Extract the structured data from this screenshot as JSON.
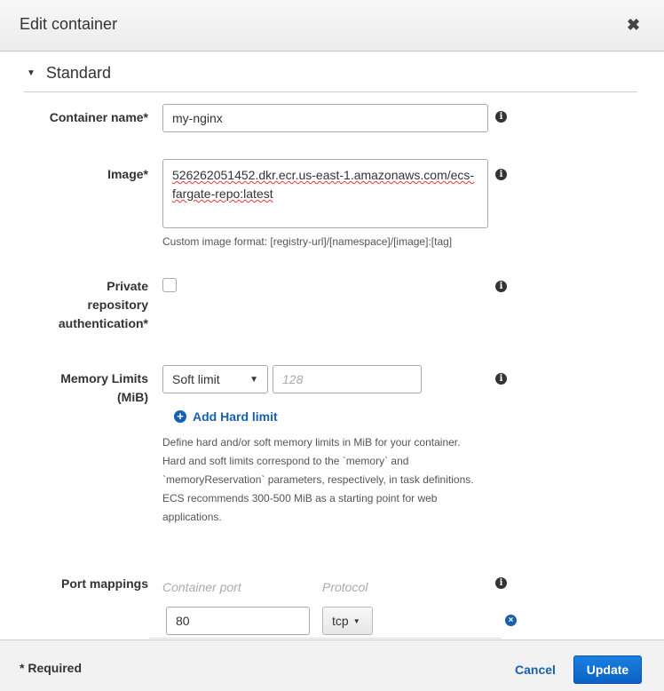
{
  "dialog": {
    "title": "Edit container",
    "close_icon": "close-icon"
  },
  "section": {
    "title": "Standard"
  },
  "container_name": {
    "label": "Container name*",
    "value": "my-nginx"
  },
  "image": {
    "label": "Image*",
    "value": "526262051452.dkr.ecr.us-east-1.amazonaws.com/ecs-fargate-repo:latest",
    "line1": "526262051452.dkr.ecr.us-east-1.amazonaws.com/ecs-",
    "line2": "fargate-repo:latest",
    "hint": "Custom image format: [registry-url]/[namespace]/[image]:[tag]"
  },
  "private_repo": {
    "label_lines": [
      "Private",
      "repository",
      "authentication*"
    ],
    "checked": false
  },
  "memory": {
    "label_lines": [
      "Memory Limits",
      "(MiB)"
    ],
    "limit_type": "Soft limit",
    "placeholder": "128",
    "add_hard_limit": "Add Hard limit",
    "help_lines": [
      "Define hard and/or soft memory limits in MiB for your container.",
      "Hard and soft limits correspond to the `memory` and",
      "`memoryReservation` parameters, respectively, in task definitions.",
      "ECS recommends 300-500 MiB as a starting point for web",
      "applications."
    ]
  },
  "ports": {
    "label": "Port mappings",
    "col_container_port": "Container port",
    "col_protocol": "Protocol",
    "rows": [
      {
        "container_port": "80",
        "protocol": "tcp"
      }
    ]
  },
  "footer": {
    "required": "* Required",
    "cancel": "Cancel",
    "update": "Update"
  },
  "colors": {
    "primary": "#0a6fd0",
    "link": "#1760b0"
  }
}
